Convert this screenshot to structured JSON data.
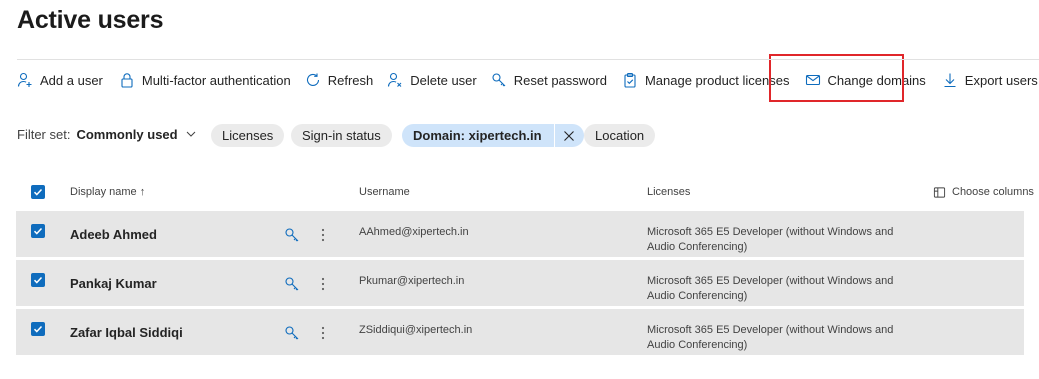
{
  "page": {
    "title": "Active users"
  },
  "toolbar": {
    "add_user": "Add a user",
    "mfa": "Multi-factor authentication",
    "refresh": "Refresh",
    "delete_user": "Delete user",
    "reset_password": "Reset password",
    "manage_licenses": "Manage product licenses",
    "change_domains": "Change domains",
    "export_users": "Export users"
  },
  "filters": {
    "label": "Filter set:",
    "selected_set": "Commonly used",
    "pills": {
      "licenses": "Licenses",
      "signin": "Sign-in status",
      "domain": "Domain: xipertech.in",
      "location": "Location"
    }
  },
  "table": {
    "headers": {
      "display_name": "Display name ↑",
      "username": "Username",
      "licenses": "Licenses",
      "choose_columns": "Choose columns"
    },
    "rows": [
      {
        "name": "Adeeb Ahmed",
        "username": "AAhmed@xipertech.in",
        "license_line1": "Microsoft 365 E5 Developer (without Windows and",
        "license_line2": "Audio Conferencing)",
        "selected": true
      },
      {
        "name": "Pankaj Kumar",
        "username": "Pkumar@xipertech.in",
        "license_line1": "Microsoft 365 E5 Developer (without Windows and",
        "license_line2": "Audio Conferencing)",
        "selected": true
      },
      {
        "name": "Zafar Iqbal Siddiqi",
        "username": "ZSiddiqui@xipertech.in",
        "license_line1": "Microsoft 365 E5 Developer (without Windows and",
        "license_line2": "Audio Conferencing)",
        "selected": true
      }
    ]
  },
  "colors": {
    "accent": "#0f6cbd",
    "highlight": "#e0262a",
    "row_bg": "#e6e6e6",
    "active_pill": "#cfe4fa"
  }
}
